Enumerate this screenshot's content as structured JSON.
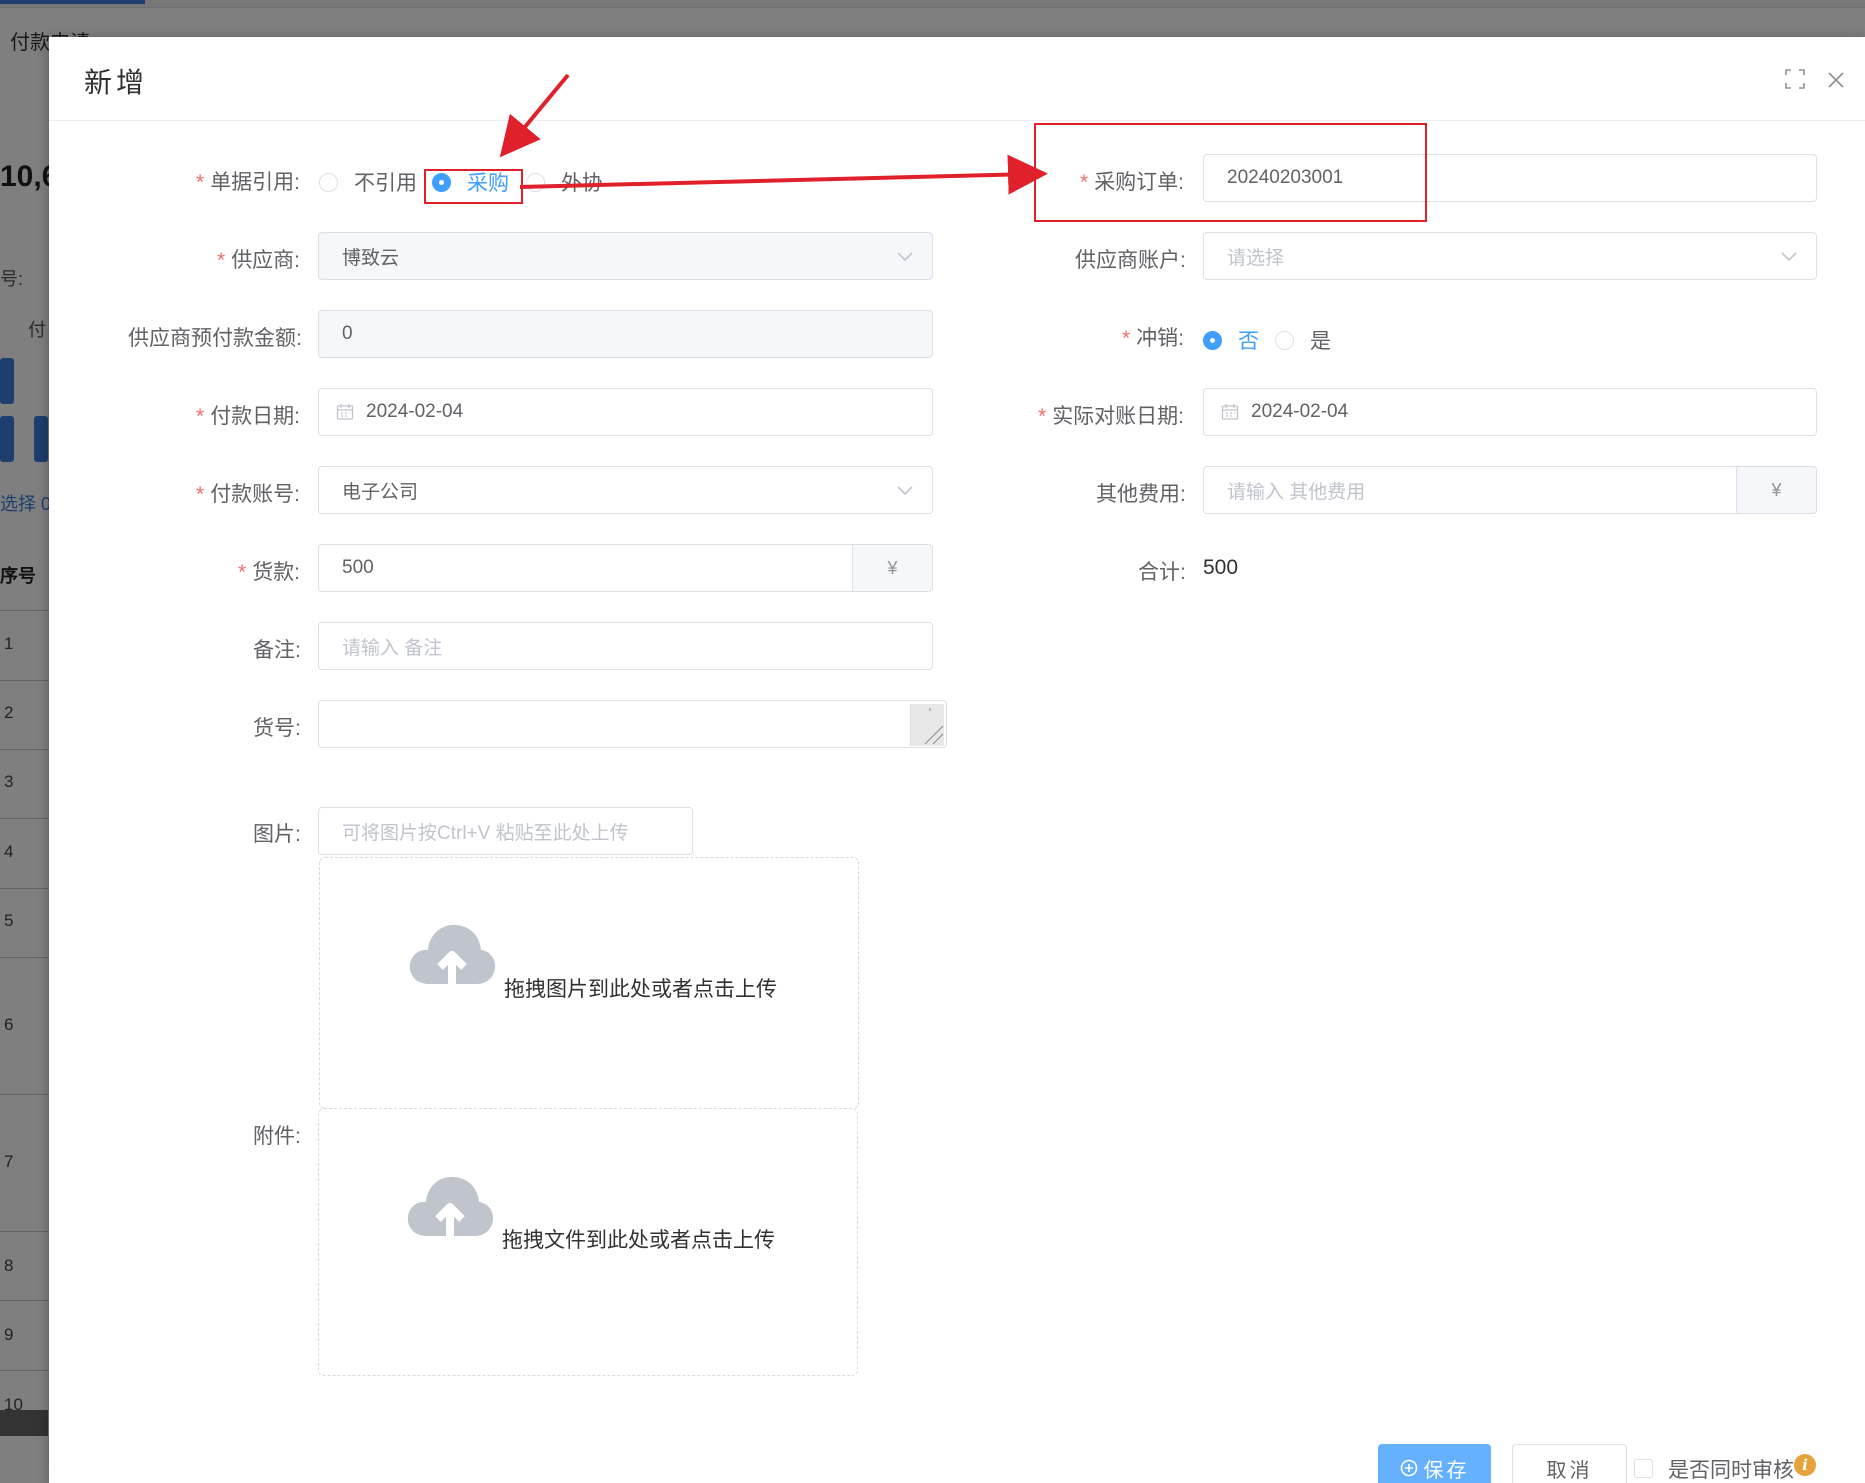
{
  "background": {
    "tab_label": "付款申请",
    "big_number": "10,6",
    "small_label_1": "号:",
    "small_label_2": "付",
    "select_text": "选择 0",
    "col_header": "序号",
    "row_numbers": [
      "1",
      "2",
      "3",
      "4",
      "5",
      "6",
      "7",
      "8",
      "9",
      "10"
    ]
  },
  "dialog": {
    "title": "新增",
    "form": {
      "doc_ref": {
        "label": "单据引用:",
        "options": [
          "不引用",
          "采购",
          "外协"
        ],
        "selected": "采购"
      },
      "purchase_order": {
        "label": "采购订单:",
        "value": "20240203001"
      },
      "supplier": {
        "label": "供应商:",
        "value": "博致云"
      },
      "supplier_account": {
        "label": "供应商账户:",
        "placeholder": "请选择"
      },
      "prepay_amount": {
        "label": "供应商预付款金额:",
        "value": "0"
      },
      "write_off": {
        "label": "冲销:",
        "options": [
          "否",
          "是"
        ],
        "selected": "否"
      },
      "pay_date": {
        "label": "付款日期:",
        "value": "2024-02-04"
      },
      "recon_date": {
        "label": "实际对账日期:",
        "value": "2024-02-04"
      },
      "pay_account": {
        "label": "付款账号:",
        "value": "电子公司"
      },
      "other_fees": {
        "label": "其他费用:",
        "placeholder": "请输入 其他费用",
        "unit": "¥"
      },
      "goods_payment": {
        "label": "货款:",
        "value": "500",
        "unit": "¥"
      },
      "total": {
        "label": "合计:",
        "value": "500"
      },
      "remark": {
        "label": "备注:",
        "placeholder": "请输入 备注"
      },
      "goods_no": {
        "label": "货号:",
        "value": ""
      },
      "image": {
        "label": "图片:",
        "paste_placeholder": "可将图片按Ctrl+V 粘贴至此处上传",
        "upload_text": "拖拽图片到此处或者点击上传"
      },
      "attachment": {
        "label": "附件:",
        "upload_text": "拖拽文件到此处或者点击上传"
      }
    },
    "footer": {
      "save_label": "保存",
      "cancel_label": "取消",
      "audit_label": "是否同时审核"
    }
  },
  "colors": {
    "primary": "#409eff",
    "required": "#f56c6c",
    "annotation": "#e0202a",
    "info": "#e6a23c"
  }
}
